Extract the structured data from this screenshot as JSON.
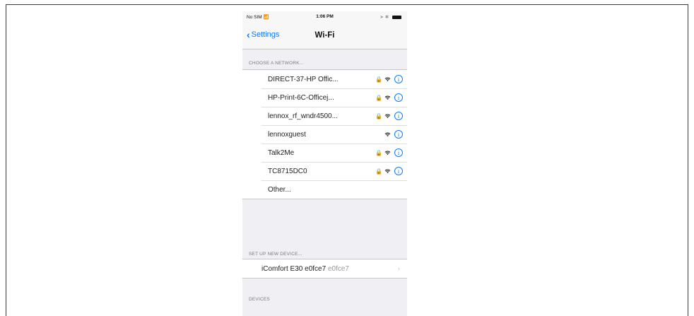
{
  "status_bar": {
    "carrier": "No SIM",
    "time": "1:06 PM"
  },
  "nav": {
    "back_label": "Settings",
    "title": "Wi-Fi"
  },
  "choose_network": {
    "header": "CHOOSE A NETWORK...",
    "networks": [
      {
        "name": "DIRECT-37-HP Offic...",
        "locked": true
      },
      {
        "name": "HP-Print-6C-Officej...",
        "locked": true
      },
      {
        "name": "lennox_rf_wndr4500...",
        "locked": true
      },
      {
        "name": "lennoxguest",
        "locked": false
      },
      {
        "name": "Talk2Me",
        "locked": true
      },
      {
        "name": "TC8715DC0",
        "locked": true
      }
    ],
    "other_label": "Other..."
  },
  "setup_device": {
    "header": "SET UP NEW DEVICE...",
    "device_name": "iComfort E30 e0fce7",
    "device_id": "e0fce7"
  },
  "devices": {
    "header": "DEVICES"
  },
  "colors": {
    "accent": "#0a7aff",
    "background": "#efeff4"
  },
  "icons": {
    "back": "chevron-left-icon",
    "lock": "lock-icon",
    "wifi": "wifi-icon",
    "info": "info-icon",
    "disclosure": "chevron-right-icon"
  }
}
